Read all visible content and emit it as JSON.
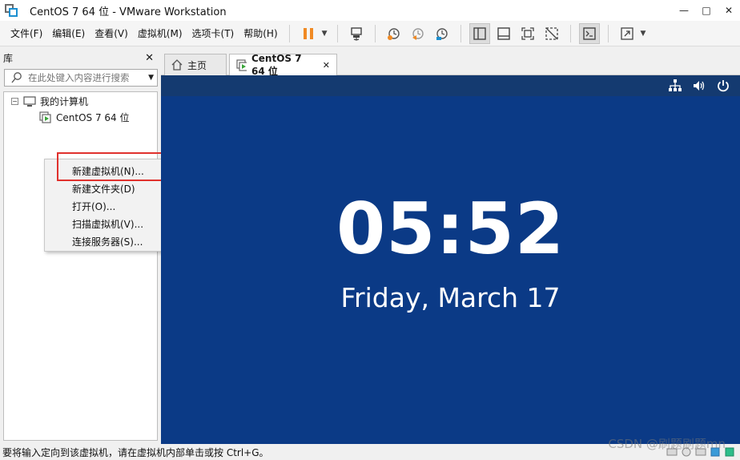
{
  "window": {
    "title": "CentOS 7 64 位 - VMware Workstation",
    "controls": {
      "minimize": "—",
      "maximize": "□",
      "close": "✕"
    }
  },
  "menu": [
    "文件(F)",
    "编辑(E)",
    "查看(V)",
    "虚拟机(M)",
    "选项卡(T)",
    "帮助(H)"
  ],
  "toolbar": {
    "accent": "#f08a24",
    "buttons": [
      "pause-icon",
      "send-ctrl-alt-del-icon",
      "snapshot-icon",
      "revert-snapshot-icon",
      "manage-snapshots-icon",
      "library-view-icon",
      "thumbnail-view-icon",
      "fullscreen-icon",
      "unity-icon",
      "console-icon",
      "stretch-icon"
    ]
  },
  "library": {
    "title": "库",
    "close": "✕",
    "search_placeholder": "在此处键入内容进行搜索",
    "tree": {
      "root": "我的计算机",
      "children": [
        "CentOS 7 64 位"
      ]
    }
  },
  "context_menu": {
    "items": [
      "新建虚拟机(N)...",
      "新建文件夹(D)",
      "打开(O)...",
      "扫描虚拟机(V)...",
      "连接服务器(S)..."
    ],
    "highlight_color": "#e0312d"
  },
  "tabs": [
    {
      "label": "主页",
      "icon": "home-icon"
    },
    {
      "label": "CentOS 7 64 位",
      "icon": "vm-running-icon",
      "close": "✕"
    }
  ],
  "vm": {
    "background": "#0b3a86",
    "time": "05:52",
    "date": "Friday, March 17",
    "top_icons": [
      "network-icon",
      "volume-icon",
      "power-icon"
    ]
  },
  "statusbar": {
    "text": "要将输入定向到该虚拟机，请在虚拟机内部单击或按 Ctrl+G。"
  },
  "watermark": "CSDN @刷题刷题mn"
}
